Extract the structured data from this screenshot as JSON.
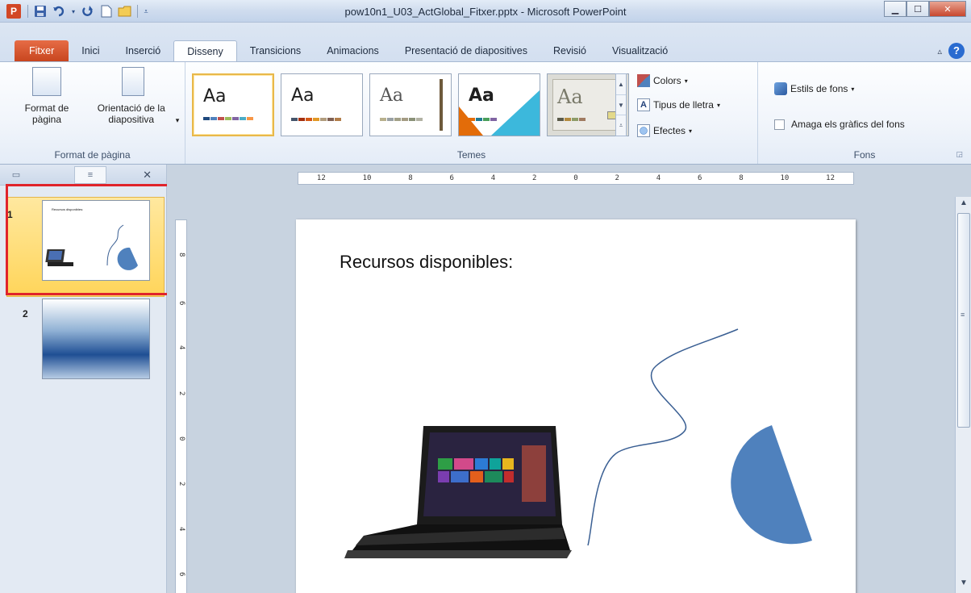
{
  "window": {
    "title": "pow10n1_U03_ActGlobal_Fitxer.pptx - Microsoft PowerPoint",
    "app_icon_letter": "P"
  },
  "tabs": [
    {
      "label": "Fitxer"
    },
    {
      "label": "Inici"
    },
    {
      "label": "Inserció"
    },
    {
      "label": "Disseny"
    },
    {
      "label": "Transicions"
    },
    {
      "label": "Animacions"
    },
    {
      "label": "Presentació de diapositives"
    },
    {
      "label": "Revisió"
    },
    {
      "label": "Visualització"
    }
  ],
  "ribbon": {
    "page_setup": {
      "format_label": "Format de pàgina",
      "orientation_label": "Orientació de la diapositiva",
      "orientation_arrow": "▾",
      "group_label": "Format de pàgina"
    },
    "themes": {
      "group_label": "Temes",
      "items": [
        {
          "aa": "Aa"
        },
        {
          "aa": "Aa"
        },
        {
          "aa": "Aa"
        },
        {
          "aa": "Aa"
        },
        {
          "aa": "Aa"
        }
      ],
      "colors_label": "Colors",
      "fonts_label": "Tipus de lletra",
      "effects_label": "Efectes"
    },
    "background": {
      "styles_label": "Estils de fons",
      "hide_graphics_label": "Amaga els gràfics del fons",
      "group_label": "Fons"
    }
  },
  "slides": [
    {
      "number": "1",
      "title": "Recursos disponibles:"
    },
    {
      "number": "2"
    }
  ],
  "ruler": {
    "horizontal": [
      "12",
      "10",
      "8",
      "6",
      "4",
      "2",
      "0",
      "2",
      "4",
      "6",
      "8",
      "10",
      "12"
    ],
    "vertical": [
      "8",
      "6",
      "4",
      "2",
      "0",
      "2",
      "4",
      "6"
    ]
  },
  "slide": {
    "title": "Recursos disponibles:"
  },
  "colors": {
    "file_tab": "#d24726",
    "shape_fill": "#4f81bd",
    "selection": "#ffd55a",
    "annotation_frame": "#e0242b"
  }
}
